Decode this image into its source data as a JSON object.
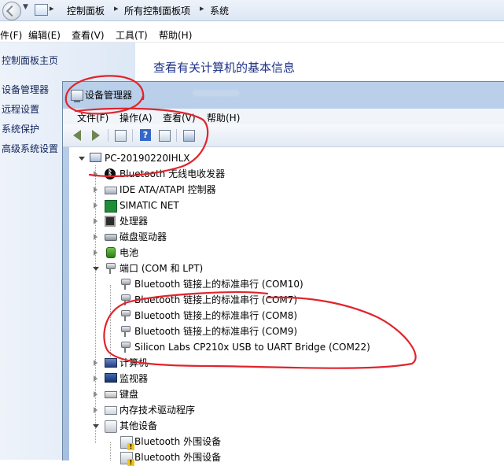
{
  "control_panel": {
    "breadcrumbs": [
      "控制面板",
      "所有控制面板项",
      "系统"
    ],
    "menu": [
      "件(F)",
      "编辑(E)",
      "查看(V)",
      "工具(T)",
      "帮助(H)"
    ],
    "sidebar_links": [
      "控制面板主页",
      "设备管理器",
      "远程设置",
      "系统保护",
      "高级系统设置"
    ],
    "main_title": "查看有关计算机的基本信息"
  },
  "device_manager": {
    "title": "设备管理器",
    "menu": [
      "文件(F)",
      "操作(A)",
      "查看(V)",
      "帮助(H)"
    ],
    "toolbar_icons": [
      "back-arrow-icon",
      "forward-arrow-icon",
      "properties-icon",
      "help-icon",
      "details-icon",
      "scan-hardware-icon"
    ],
    "tree": {
      "root": "PC-20190220IHLX",
      "categories": [
        {
          "label": "Bluetooth 无线电收发器",
          "icon": "bluetooth-icon",
          "expanded": false
        },
        {
          "label": "IDE ATA/ATAPI 控制器",
          "icon": "ide-controller-icon",
          "expanded": false
        },
        {
          "label": "SIMATIC NET",
          "icon": "network-icon",
          "expanded": false
        },
        {
          "label": "处理器",
          "icon": "processor-icon",
          "expanded": false
        },
        {
          "label": "磁盘驱动器",
          "icon": "disk-drive-icon",
          "expanded": false
        },
        {
          "label": "电池",
          "icon": "battery-icon",
          "expanded": false
        },
        {
          "label": "端口 (COM 和 LPT)",
          "icon": "port-icon",
          "expanded": true,
          "children": [
            "Bluetooth 链接上的标准串行 (COM10)",
            "Bluetooth 链接上的标准串行 (COM7)",
            "Bluetooth 链接上的标准串行 (COM8)",
            "Bluetooth 链接上的标准串行 (COM9)",
            "Silicon Labs CP210x USB to UART Bridge (COM22)"
          ]
        },
        {
          "label": "计算机",
          "icon": "computer-icon",
          "expanded": false
        },
        {
          "label": "监视器",
          "icon": "monitor-icon",
          "expanded": false
        },
        {
          "label": "键盘",
          "icon": "keyboard-icon",
          "expanded": false
        },
        {
          "label": "内存技术驱动程序",
          "icon": "memory-icon",
          "expanded": false
        },
        {
          "label": "其他设备",
          "icon": "other-devices-icon",
          "expanded": true,
          "children": [
            "Bluetooth 外围设备",
            "Bluetooth 外围设备"
          ]
        }
      ]
    }
  },
  "colors": {
    "annotation_red": "#e0242c",
    "link_blue": "#1e3287",
    "window_frame": "#a6bfdf"
  }
}
